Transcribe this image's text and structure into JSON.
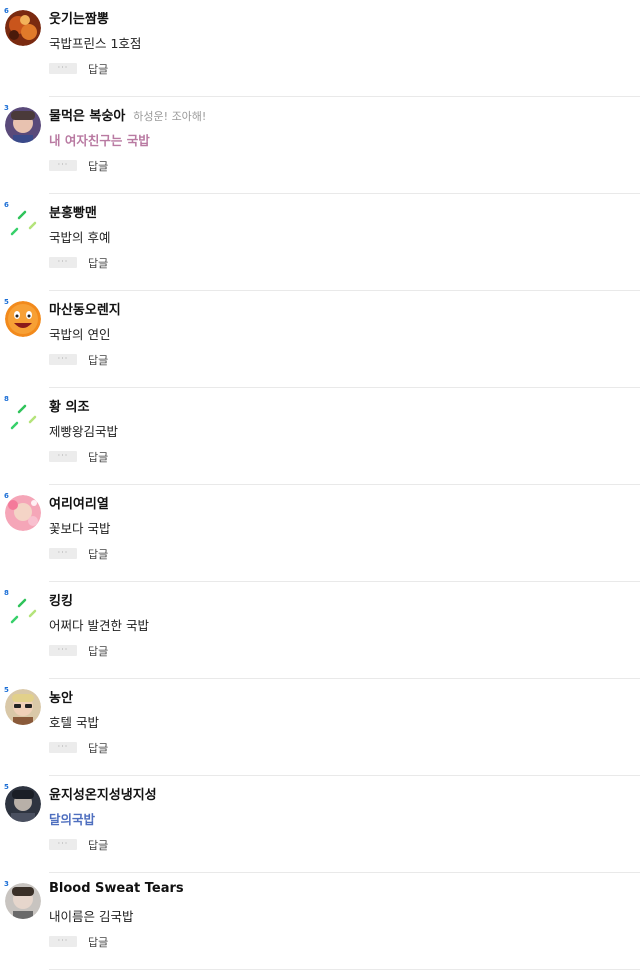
{
  "more_label": "···",
  "reply_label": "답글",
  "comments": [
    {
      "level": "6",
      "nickname": "웃기는짬뽕",
      "mention": "",
      "text": "국밥프린스 1호점",
      "text_style": "normal",
      "avatar": "photo-food"
    },
    {
      "level": "3",
      "nickname": "물먹은 복숭아",
      "mention": "하성운! 조아해!",
      "text": "내 여자친구는 국밥",
      "text_style": "pink",
      "avatar": "photo-boy"
    },
    {
      "level": "6",
      "nickname": "분홍빵맨",
      "mention": "",
      "text": "국밥의 후예",
      "text_style": "normal",
      "avatar": "placeholder"
    },
    {
      "level": "5",
      "nickname": "마산동오렌지",
      "mention": "",
      "text": "국밥의 연인",
      "text_style": "normal",
      "avatar": "photo-orange"
    },
    {
      "level": "8",
      "nickname": "황 의조",
      "mention": "",
      "text": "제빵왕김국밥",
      "text_style": "normal",
      "avatar": "placeholder"
    },
    {
      "level": "6",
      "nickname": "여리여리열",
      "mention": "",
      "text": "꽃보다 국밥",
      "text_style": "normal",
      "avatar": "photo-pink"
    },
    {
      "level": "8",
      "nickname": "킹킹",
      "mention": "",
      "text": "어쩌다 발견한 국밥",
      "text_style": "normal",
      "avatar": "placeholder"
    },
    {
      "level": "5",
      "nickname": "농안",
      "mention": "",
      "text": "호텔 국밥",
      "text_style": "normal",
      "avatar": "photo-sunglasses"
    },
    {
      "level": "5",
      "nickname": "윤지성온지성냉지성",
      "mention": "",
      "text": "달의국밥",
      "text_style": "blue",
      "avatar": "photo-dark"
    },
    {
      "level": "3",
      "nickname": "Blood Sweat Tears",
      "mention": "",
      "text": "내이름은 김국밥",
      "text_style": "normal",
      "avatar": "photo-portrait"
    }
  ]
}
